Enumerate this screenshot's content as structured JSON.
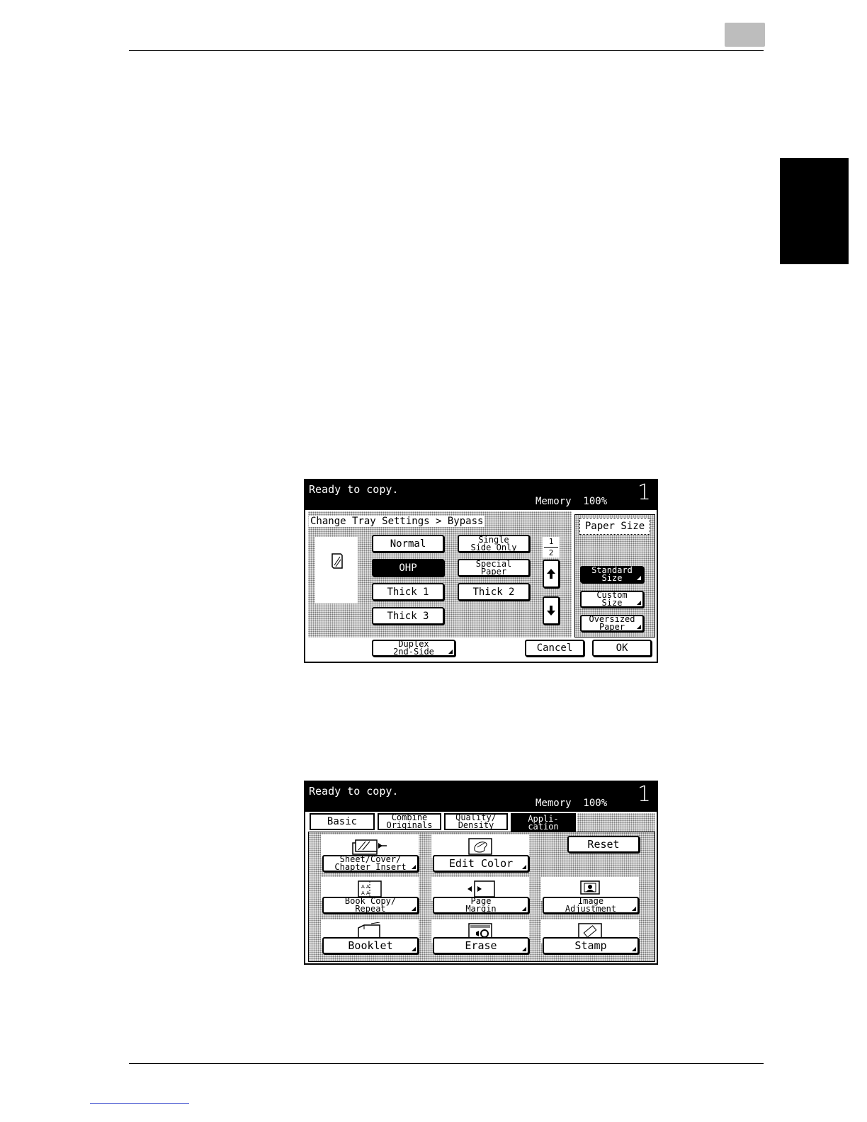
{
  "screen1": {
    "status": {
      "message": "Ready to copy.",
      "memory": "Memory  100%",
      "count": "1"
    },
    "breadcrumb": "Change Tray Settings > Bypass",
    "paper_types": {
      "normal": "Normal",
      "ohp": "OHP",
      "thick1": "Thick 1",
      "thick3": "Thick 3",
      "single_side": "Single\nSide Only",
      "special": "Special\nPaper",
      "thick2": "Thick 2"
    },
    "selected_type": "OHP",
    "page_indicator": {
      "current": "1",
      "total": "2"
    },
    "paper_size": {
      "label": "Paper Size",
      "standard": "Standard\nSize",
      "custom": "Custom\nSize",
      "oversized": "Oversized\nPaper",
      "selected": "Standard Size"
    },
    "duplex": "Duplex\n2nd-Side",
    "cancel": "Cancel",
    "ok": "OK"
  },
  "screen2": {
    "status": {
      "message": "Ready to copy.",
      "memory": "Memory  100%",
      "count": "1"
    },
    "tabs": [
      "Basic",
      "Combine\nOriginals",
      "Quality/\nDensity",
      "Appli-\ncation"
    ],
    "active_tab": "Appli-cation",
    "functions": {
      "sheet": "Sheet/Cover/\nChapter Insert",
      "edit_color": "Edit Color",
      "reset": "Reset",
      "book_copy": "Book Copy/\nRepeat",
      "page_margin": "Page\nMargin",
      "image_adjust": "Image\nAdjustment",
      "booklet": "Booklet",
      "erase": "Erase",
      "stamp": "Stamp"
    }
  }
}
